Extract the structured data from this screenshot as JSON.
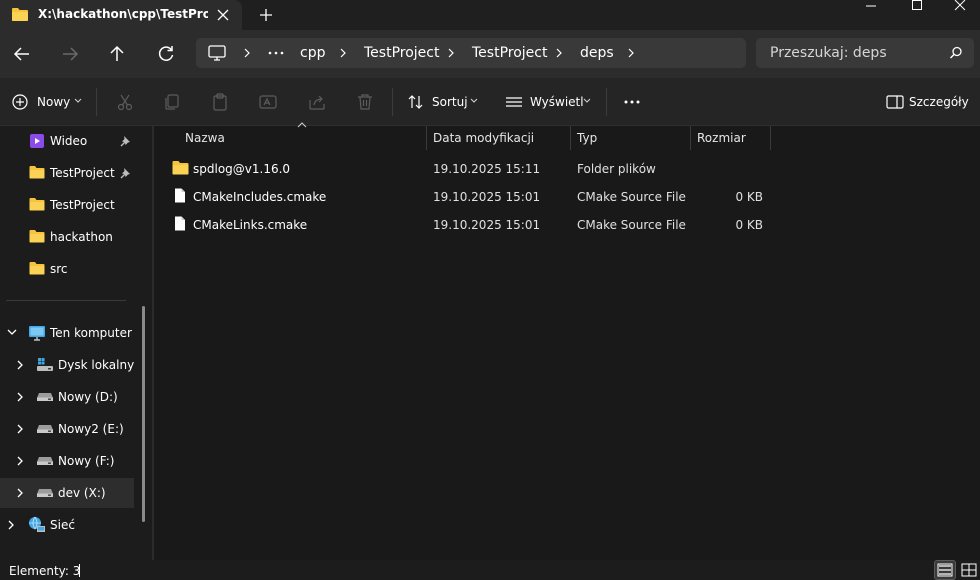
{
  "tab": {
    "title": "X:\\hackathon\\cpp\\TestProject"
  },
  "breadcrumbs": [
    {
      "label": "cpp"
    },
    {
      "label": "TestProject"
    },
    {
      "label": "TestProject"
    },
    {
      "label": "deps"
    }
  ],
  "search": {
    "placeholder": "Przeszukaj: deps"
  },
  "toolbar": {
    "new_label": "Nowy",
    "sort_label": "Sortuj",
    "view_label": "Wyświetl",
    "details_label": "Szczegóły"
  },
  "nav": {
    "quick_access": [
      {
        "label": "Wideo",
        "icon": "video-folder-icon",
        "pinned": true
      },
      {
        "label": "TestProject",
        "icon": "folder-icon",
        "pinned": true
      },
      {
        "label": "TestProject",
        "icon": "folder-icon",
        "pinned": false
      },
      {
        "label": "hackathon",
        "icon": "folder-icon",
        "pinned": false
      },
      {
        "label": "src",
        "icon": "folder-icon",
        "pinned": false
      }
    ],
    "this_pc": {
      "label": "Ten komputer",
      "icon": "computer-icon"
    },
    "drives": [
      {
        "label": "Dysk lokalny (C",
        "icon": "local-disk-icon"
      },
      {
        "label": "Nowy (D:)",
        "icon": "drive-icon"
      },
      {
        "label": "Nowy2 (E:)",
        "icon": "drive-icon"
      },
      {
        "label": "Nowy (F:)",
        "icon": "drive-icon"
      },
      {
        "label": "dev (X:)",
        "icon": "drive-icon",
        "selected": true
      }
    ],
    "network": {
      "label": "Sieć",
      "icon": "network-icon"
    }
  },
  "columns": {
    "name": "Nazwa",
    "modified": "Data modyfikacji",
    "type": "Typ",
    "size": "Rozmiar"
  },
  "files": [
    {
      "name": "spdlog@v1.16.0",
      "modified": "19.10.2025 15:11",
      "type": "Folder plików",
      "size": "",
      "icon": "folder-icon"
    },
    {
      "name": "CMakeIncludes.cmake",
      "modified": "19.10.2025 15:01",
      "type": "CMake Source File",
      "size": "0 KB",
      "icon": "file-icon"
    },
    {
      "name": "CMakeLinks.cmake",
      "modified": "19.10.2025 15:01",
      "type": "CMake Source File",
      "size": "0 KB",
      "icon": "file-icon"
    }
  ],
  "status": {
    "items_text": "Elementy: 3"
  },
  "colors": {
    "folder": "#f8c23a",
    "background": "#191919",
    "toolbar": "#252525"
  }
}
